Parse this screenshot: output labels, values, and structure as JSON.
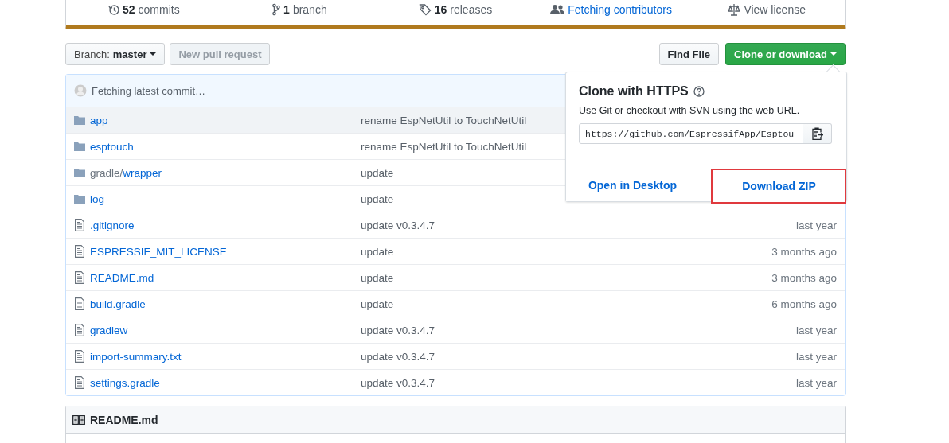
{
  "stats": [
    {
      "kind": "commits",
      "count": "52",
      "label": "commits"
    },
    {
      "kind": "branches",
      "count": "1",
      "label": "branch"
    },
    {
      "kind": "releases",
      "count": "16",
      "label": "releases"
    },
    {
      "kind": "contributors",
      "label": "Fetching contributors"
    },
    {
      "kind": "license",
      "label": "View license"
    }
  ],
  "branch_select": {
    "label": "Branch:",
    "value": "master"
  },
  "new_pull_request": {
    "label": "New pull request",
    "disabled": true
  },
  "find_file": {
    "label": "Find File"
  },
  "clone_button": {
    "label": "Clone or download",
    "expanded": true
  },
  "latest_commit": {
    "text": "Fetching latest commit…"
  },
  "files": [
    {
      "kind": "dir",
      "name": "app",
      "message": "rename EspNetUtil to TouchNetUtil",
      "hovered": true
    },
    {
      "kind": "dir",
      "name": "esptouch",
      "message": "rename EspNetUtil to TouchNetUtil",
      "hovered": false
    },
    {
      "kind": "dir",
      "prefix": "gradle/",
      "name": "wrapper",
      "message": "update",
      "hovered": false
    },
    {
      "kind": "dir",
      "name": "log",
      "message": "update",
      "hovered": false
    },
    {
      "kind": "file",
      "name": ".gitignore",
      "message": "update v0.3.4.7",
      "age": "last year",
      "hovered": false
    },
    {
      "kind": "file",
      "name": "ESPRESSIF_MIT_LICENSE",
      "message": "update",
      "age": "3 months ago",
      "hovered": false
    },
    {
      "kind": "file",
      "name": "README.md",
      "message": "update",
      "age": "3 months ago",
      "hovered": false
    },
    {
      "kind": "file",
      "name": "build.gradle",
      "message": "update",
      "age": "6 months ago",
      "hovered": false
    },
    {
      "kind": "file",
      "name": "gradlew",
      "message": "update v0.3.4.7",
      "age": "last year",
      "hovered": false
    },
    {
      "kind": "file",
      "name": "import-summary.txt",
      "message": "update v0.3.4.7",
      "age": "last year",
      "hovered": false
    },
    {
      "kind": "file",
      "name": "settings.gradle",
      "message": "update v0.3.4.7",
      "age": "last year",
      "hovered": false
    }
  ],
  "clone_popup": {
    "title": "Clone with HTTPS",
    "description": "Use Git or checkout with SVN using the web URL.",
    "url": "https://github.com/EspressifApp/Esptou",
    "actions": [
      {
        "label": "Open in Desktop",
        "highlighted": false
      },
      {
        "label": "Download ZIP",
        "highlighted": true
      }
    ]
  },
  "readme": {
    "title": "README.md"
  }
}
